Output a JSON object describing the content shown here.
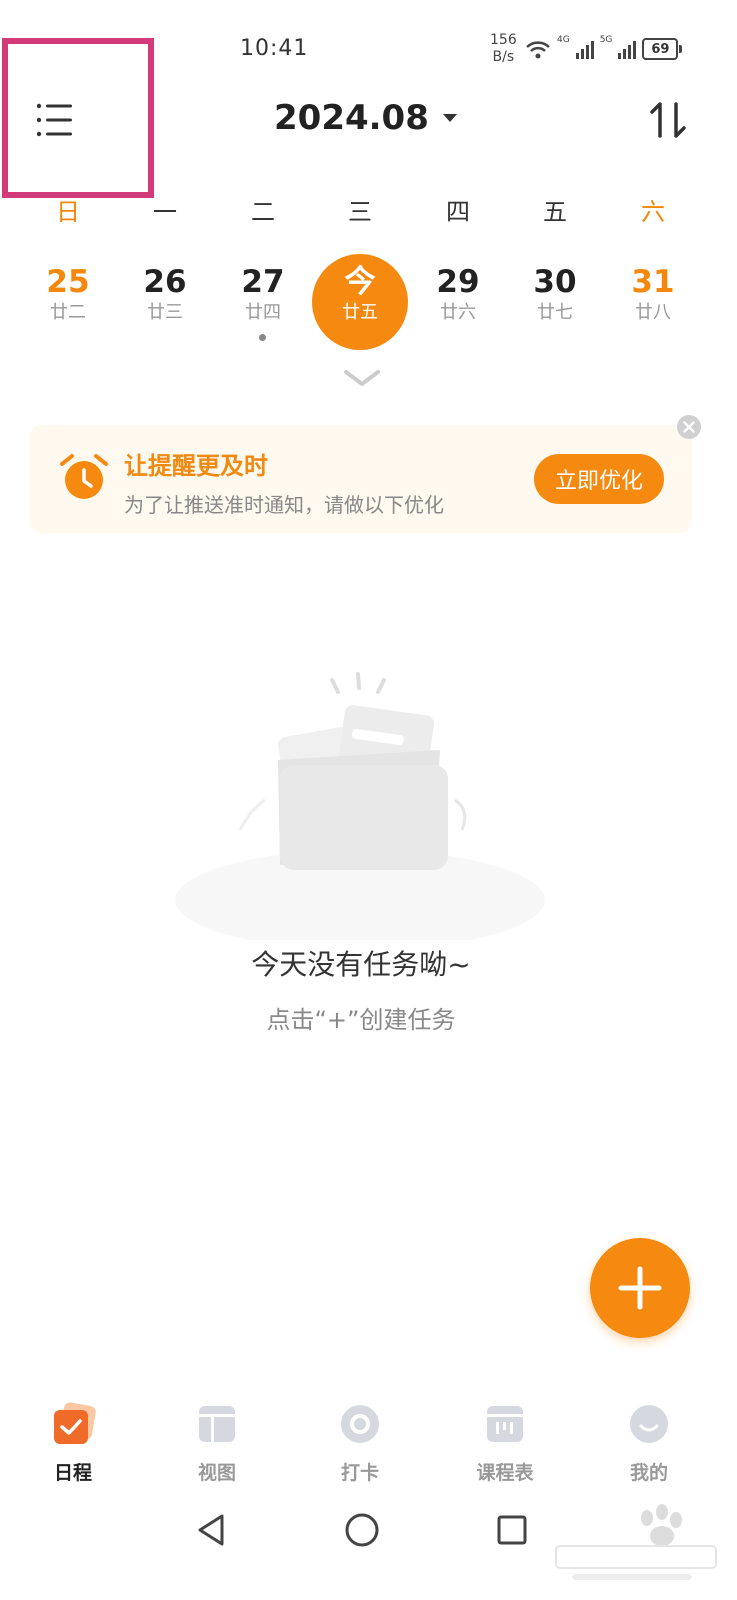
{
  "status_bar": {
    "time": "10:41",
    "net_speed_value": "156",
    "net_speed_unit": "B/s",
    "signal_1_tag": "4G",
    "signal_2_tag": "5G",
    "battery": "69"
  },
  "header": {
    "month": "2024.08"
  },
  "week": {
    "weekdays": [
      "日",
      "一",
      "二",
      "三",
      "四",
      "五",
      "六"
    ],
    "days": [
      {
        "num": "25",
        "lunar": "廿二"
      },
      {
        "num": "26",
        "lunar": "廿三"
      },
      {
        "num": "27",
        "lunar": "廿四"
      },
      {
        "num": "今",
        "lunar": "廿五"
      },
      {
        "num": "29",
        "lunar": "廿六"
      },
      {
        "num": "30",
        "lunar": "廿七"
      },
      {
        "num": "31",
        "lunar": "廿八"
      }
    ]
  },
  "banner": {
    "title": "让提醒更及时",
    "subtitle": "为了让推送准时通知，请做以下优化",
    "button": "立即优化"
  },
  "empty_state": {
    "title": "今天没有任务呦~",
    "subtitle": "点击“+”创建任务"
  },
  "tabs": [
    {
      "label": "日程",
      "icon": "schedule-icon",
      "active": true
    },
    {
      "label": "视图",
      "icon": "view-icon",
      "active": false
    },
    {
      "label": "打卡",
      "icon": "checkin-icon",
      "active": false
    },
    {
      "label": "课程表",
      "icon": "timetable-icon",
      "active": false
    },
    {
      "label": "我的",
      "icon": "profile-icon",
      "active": false
    }
  ],
  "colors": {
    "accent": "#f68a10",
    "highlight": "#d33a7a"
  }
}
